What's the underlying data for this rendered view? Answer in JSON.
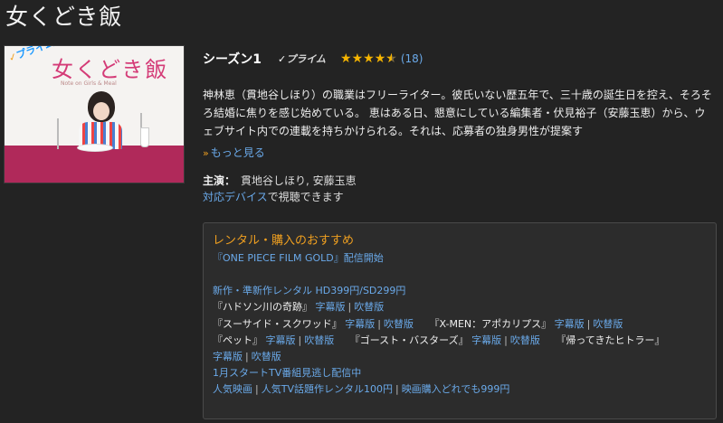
{
  "title": "女くどき飯",
  "poster": {
    "prime_flag": "プライム",
    "logo": "女くどき飯",
    "logo_sub": "Note on Girls & Meal"
  },
  "info": {
    "season": "シーズン1",
    "prime_label": "プライム",
    "rating_stars": 4.5,
    "rating_count": "(18)",
    "synopsis": "神林恵（貫地谷しほり）の職業はフリーライター。彼氏いない歴五年で、三十歳の誕生日を控え、そろそろ結婚に焦りを感じ始めている。 恵はある日、懇意にしている編集者・伏見裕子（安藤玉恵）から、ウェブサイト内での連載を持ちかけられる。それは、応募者の独身男性が提案す",
    "more": "もっと見る",
    "cast_label": "主演：",
    "cast": "貫地谷しほり, 安藤玉恵",
    "device_link": "対応デバイス",
    "device_text": "で視聴できます"
  },
  "promo": {
    "title": "レンタル・購入のおすすめ",
    "onepiece": "『ONE PIECE FILM GOLD』配信開始",
    "new_rental": "新作・準新作レンタル HD399円/SD299円",
    "movie1": "『ハドソン川の奇跡』",
    "subtitles": "字幕版",
    "dubbed": "吹替版",
    "movie2": "『スーサイド・スクワッド』",
    "movie3": "『X-MEN：アポカリプス』",
    "movie4": "『ペット』",
    "movie5": "『ゴースト・バスターズ』",
    "movie6": "『帰ってきたヒトラー』",
    "tv_line": "1月スタートTV番組見逃し配信中",
    "popular_movies": "人気映画",
    "popular_tv": "人気TV話題作レンタル100円",
    "buy_999": "映画購入どれでも999円",
    "separator": "|"
  }
}
